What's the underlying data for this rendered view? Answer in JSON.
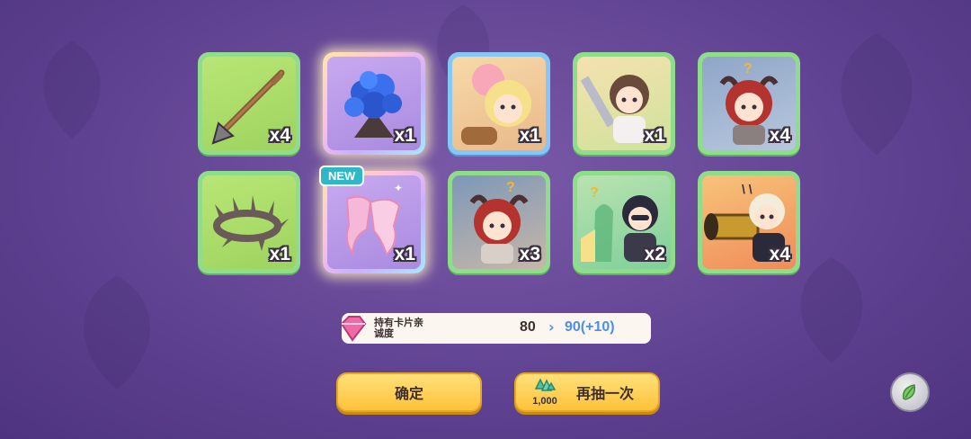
{
  "rewards": [
    {
      "name": "spear",
      "qty": "x4",
      "new": false
    },
    {
      "name": "blue-rose-bouquet",
      "qty": "x1",
      "new": false
    },
    {
      "name": "character-card-pink-blonde",
      "qty": "x1",
      "new": false
    },
    {
      "name": "character-card-knight",
      "qty": "x1",
      "new": false
    },
    {
      "name": "character-card-red-horned",
      "qty": "x4",
      "new": false
    },
    {
      "name": "thorn-crown",
      "qty": "x1",
      "new": false
    },
    {
      "name": "pink-ribbon-cloth",
      "qty": "x1",
      "new": true
    },
    {
      "name": "character-card-red-horned-2",
      "qty": "x3",
      "new": false
    },
    {
      "name": "character-card-dark-haired",
      "qty": "x2",
      "new": false
    },
    {
      "name": "character-card-cannon",
      "qty": "x4",
      "new": false
    }
  ],
  "new_badge": "NEW",
  "affection": {
    "label": "持有卡片亲诚度",
    "from": "80",
    "arrow": "›",
    "to": "90(+10)"
  },
  "buttons": {
    "confirm": "确定",
    "again": "再抽一次",
    "again_cost": "1,000"
  },
  "colors": {
    "accent_yellow": "#ffc23a",
    "card_green": "#8fdc8a",
    "card_blue": "#86c8f5",
    "increase_blue": "#4d8ee8"
  }
}
